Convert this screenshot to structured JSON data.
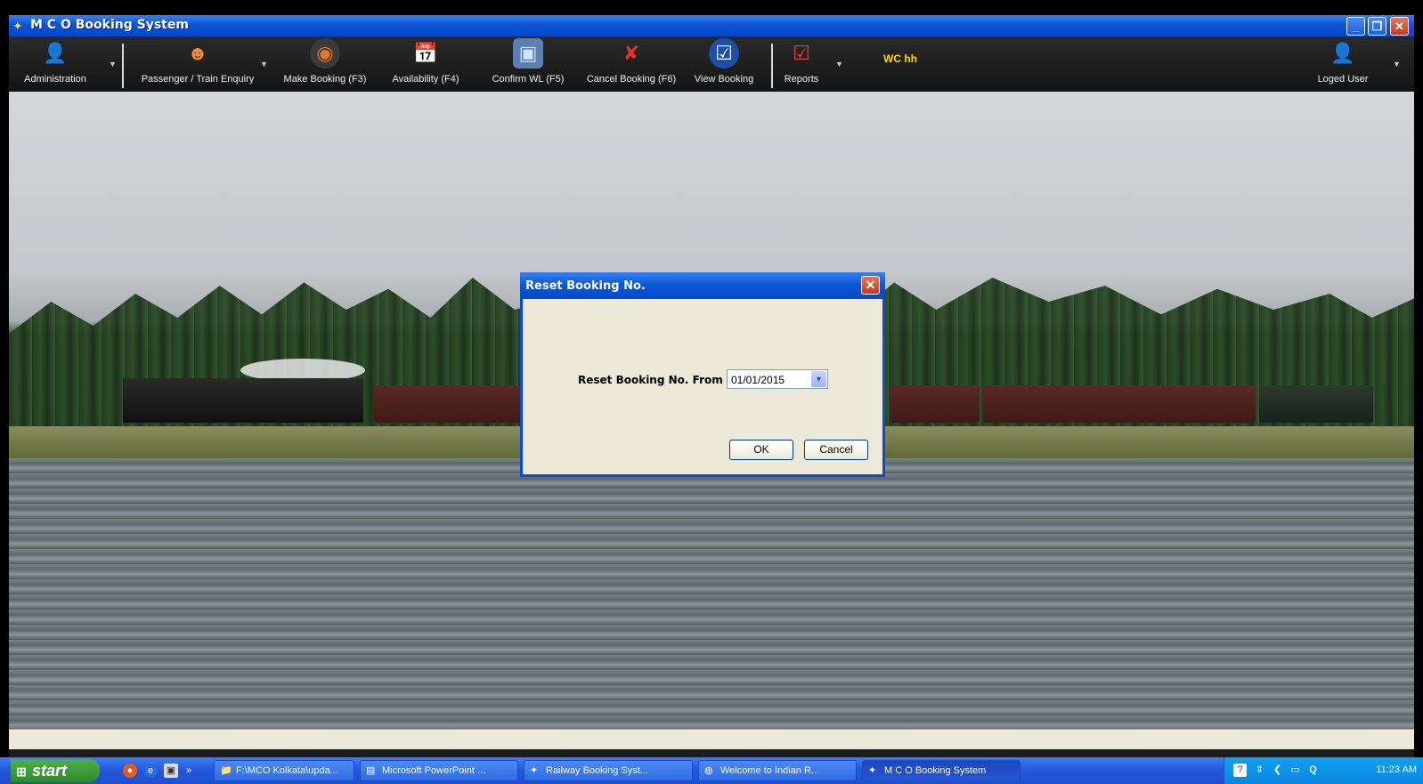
{
  "window": {
    "title": "M C O Booking System",
    "controls": {
      "minimize": "_",
      "restore": "❐",
      "close": "✕"
    }
  },
  "toolbar": {
    "items": [
      {
        "label": "Administration",
        "icon": "admin-user-add-icon"
      },
      {
        "label": "Passenger / Train Enquiry",
        "icon": "passenger-icon"
      },
      {
        "label": "Make Booking  (F3)",
        "icon": "booking-icon"
      },
      {
        "label": "Availability (F4)",
        "icon": "calendar-icon"
      },
      {
        "label": "Confirm WL (F5)",
        "icon": "confirm-icon"
      },
      {
        "label": "Cancel Booking (F6)",
        "icon": "cancel-icon"
      },
      {
        "label": "View Booking",
        "icon": "checkbox-icon"
      },
      {
        "label": "Reports",
        "icon": "clipboard-icon"
      },
      {
        "label": "Loged User",
        "icon": "user-icon"
      }
    ],
    "station_code": "WC hh"
  },
  "dialog": {
    "title": "Reset Booking No.",
    "field_label": "Reset Booking No. From",
    "date_value": "01/01/2015",
    "ok_label": "OK",
    "cancel_label": "Cancel"
  },
  "taskbar": {
    "start_label": "start",
    "tasks": [
      {
        "label": "F:\\MCO Kolkata\\upda...",
        "icon": "folder-icon"
      },
      {
        "label": "Microsoft PowerPoint ...",
        "icon": "powerpoint-icon"
      },
      {
        "label": "Railway Booking Syst...",
        "icon": "app-icon"
      },
      {
        "label": "Welcome to Indian R...",
        "icon": "browser-icon"
      },
      {
        "label": "M C O Booking System",
        "icon": "app-icon"
      }
    ],
    "clock": "11:23 AM"
  }
}
